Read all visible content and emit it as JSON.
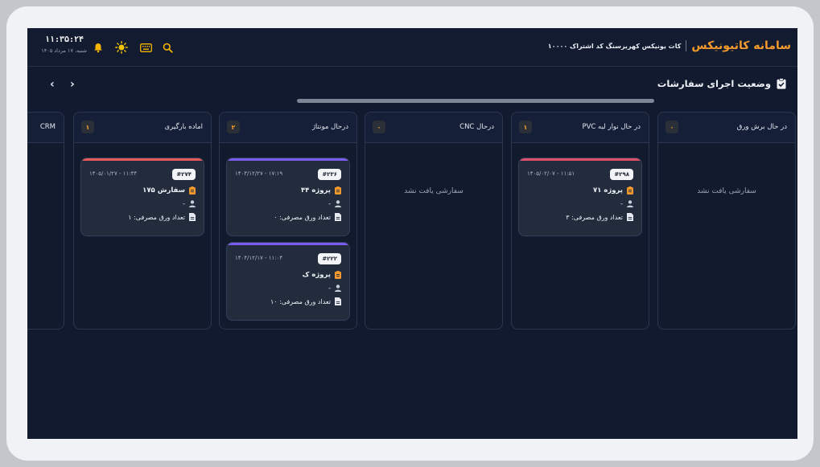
{
  "header": {
    "app_title": "سامانه کاتیونیکس",
    "company": "کات یونیکس کهریزسنگ کد اشتراک ۱۰۰۰۰",
    "time": "۱۱:۳۵:۲۴",
    "date": "شنبه، ۱۷ مرداد ۱۴۰۵"
  },
  "page": {
    "title": "وضعیت اجرای سفارشات",
    "prev_label": "‹",
    "next_label": "›"
  },
  "columns": [
    {
      "title": "در حال برش ورق",
      "count": "۰",
      "empty_text": "سفارشی یافت نشد"
    },
    {
      "title": "در حال نوار لبه PVC",
      "count": "۱"
    },
    {
      "title": "درحال CNC",
      "count": "۰",
      "empty_text": "سفارشی یافت نشد"
    },
    {
      "title": "درحال مونتاژ",
      "count": "۲"
    },
    {
      "title": "اماده بارگیری",
      "count": "۱"
    },
    {
      "title": "CRM"
    }
  ],
  "cards": {
    "pvc": [
      {
        "tag": "#۲۹۸",
        "datetime": "۱۴۰۵/۰۲/۰۷ - ۱۱:۵۱",
        "name": "پروژه ۷۱",
        "customer": "-",
        "sheets": "تعداد ورق مصرفی: ۳",
        "accent": "#e0506b"
      }
    ],
    "assembly": [
      {
        "tag": "#۲۳۶",
        "datetime": "۱۴۰۴/۱۲/۲۷ - ۱۷:۱۹",
        "name": "پروژه ۴۴",
        "customer": "-",
        "sheets": "تعداد ورق مصرفی: ۰",
        "accent": "#7b5cf0"
      },
      {
        "tag": "#۲۲۲",
        "datetime": "۱۴۰۴/۱۲/۱۷ - ۱۱:۰۴",
        "name": "پروژه ک",
        "customer": "-",
        "sheets": "تعداد ورق مصرفی: ۱۰",
        "accent": "#7b5cf0"
      }
    ],
    "ready": [
      {
        "tag": "#۲۷۴",
        "datetime": "۱۴۰۵/۰۱/۲۷ - ۱۱:۴۴",
        "name": "سفارش ۱۷۵",
        "customer": "-",
        "sheets": "تعداد ورق مصرفی: ۱",
        "accent": "#e85a5a"
      }
    ]
  },
  "colors": {
    "accent": "#f39a2e",
    "background": "#111a2e",
    "bell": "#f5b400"
  },
  "icons": [
    "search-icon",
    "keyboard-icon",
    "sun-icon",
    "bell-icon",
    "clipboard-check-icon",
    "order-icon",
    "user-icon",
    "file-icon"
  ]
}
